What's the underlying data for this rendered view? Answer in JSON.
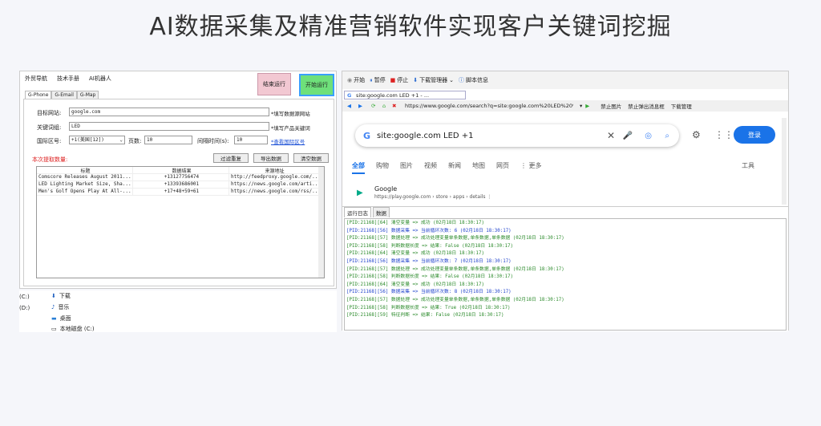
{
  "header": {
    "title": "AI数据采集及精准营销软件实现客户关键词挖掘"
  },
  "left_app": {
    "menu": [
      "外贸导航",
      "技术手册",
      "AI机器人"
    ],
    "tabs": [
      "G-Phone",
      "G-Email",
      "G-Map"
    ],
    "end_button": "结束运行",
    "start_button": "开始运行",
    "site_label": "目标网站:",
    "site_value": "google.com",
    "site_note": "*填写数据源网站",
    "keyword_label": "关键词组:",
    "keyword_value": "LED",
    "keyword_note": "*填写产品关键词",
    "country_label": "国际区号:",
    "country_value": "+1(美国[12])",
    "page_label": "页数:",
    "page_value": "10",
    "interval_label": "间隔时间(s):",
    "interval_value": "10",
    "country_link": "*查看国际区号",
    "count_label": "本次提取数量:",
    "filter_button": "过滤重复",
    "export_button": "导出数据",
    "clear_button": "清空数据",
    "table_headers": [
      "标题",
      "数据结果",
      "来源地址"
    ],
    "table_rows": [
      [
        "Comscore Releases August 2011...",
        "+13127756474",
        "http://feedproxy.google.com/..."
      ],
      [
        "LED Lighting Market Size, Sha...",
        "+13393686001",
        "https://news.google.com/arti..."
      ],
      [
        "Men's Golf Opens Play At All-...",
        "+17+48+59+61",
        "https://news.google.com/rss/..."
      ]
    ]
  },
  "explorer": {
    "items": [
      "下载",
      "音乐",
      "桌面",
      "本地磁盘 (C:)"
    ],
    "drives": [
      "(C:)",
      "(D:)"
    ]
  },
  "browser": {
    "toolbar": [
      "开始",
      "暂停",
      "停止",
      "下载管理器",
      "脚本信息"
    ],
    "tab_title": "site:google.com LED +1 - ...",
    "url": "https://www.google.com/search?q=site:google.com%20LED%20%...",
    "addr_actions": [
      "禁止图片",
      "禁止弹出消息框",
      "下载管理"
    ],
    "search_query": "site:google.com LED +1",
    "login_button": "登录",
    "nav": [
      "全部",
      "购物",
      "图片",
      "视频",
      "新闻",
      "地图",
      "网页",
      "⋮ 更多"
    ],
    "tools": "工具",
    "result_title": "Google",
    "result_url": "https://play.google.com › store › apps › details  ⋮",
    "log_tabs": [
      "运行日志",
      "数据"
    ],
    "log_lines": [
      {
        "t": "[PID:21168][64] 清空变量 => 成功 (02月18日 18:30:17)",
        "c": "g"
      },
      {
        "t": "[PID:21168][56] 数据采集 => 当前循环次数: 6 (02月18日 18:30:17)",
        "c": "b"
      },
      {
        "t": "[PID:21168][57] 数据处理 => 成功处理变量单条数据,单条数据,单条数据 (02月18日 18:30:17)",
        "c": "g"
      },
      {
        "t": "[PID:21168][58] 判断数据长度 => 结果: False (02月18日 18:30:17)",
        "c": "g"
      },
      {
        "t": "[PID:21168][64] 清空变量 => 成功 (02月18日 18:30:17)",
        "c": "g"
      },
      {
        "t": "[PID:21168][56] 数据采集 => 当前循环次数: 7 (02月18日 18:30:17)",
        "c": "b"
      },
      {
        "t": "[PID:21168][57] 数据处理 => 成功处理变量单条数据,单条数据,单条数据 (02月18日 18:30:17)",
        "c": "g"
      },
      {
        "t": "[PID:21168][58] 判断数据长度 => 结果: False (02月18日 18:30:17)",
        "c": "g"
      },
      {
        "t": "[PID:21168][64] 清空变量 => 成功 (02月18日 18:30:17)",
        "c": "g"
      },
      {
        "t": "[PID:21168][56] 数据采集 => 当前循环次数: 8 (02月18日 18:30:17)",
        "c": "b"
      },
      {
        "t": "[PID:21168][57] 数据处理 => 成功处理变量单条数据,单条数据,单条数据 (02月18日 18:30:17)",
        "c": "g"
      },
      {
        "t": "[PID:21168][58] 判断数据长度 => 结果: True (02月18日 18:30:17)",
        "c": "g"
      },
      {
        "t": "[PID:21168][59] 特征判断 => 结果: False (02月18日 18:30:17)",
        "c": "g"
      }
    ]
  }
}
